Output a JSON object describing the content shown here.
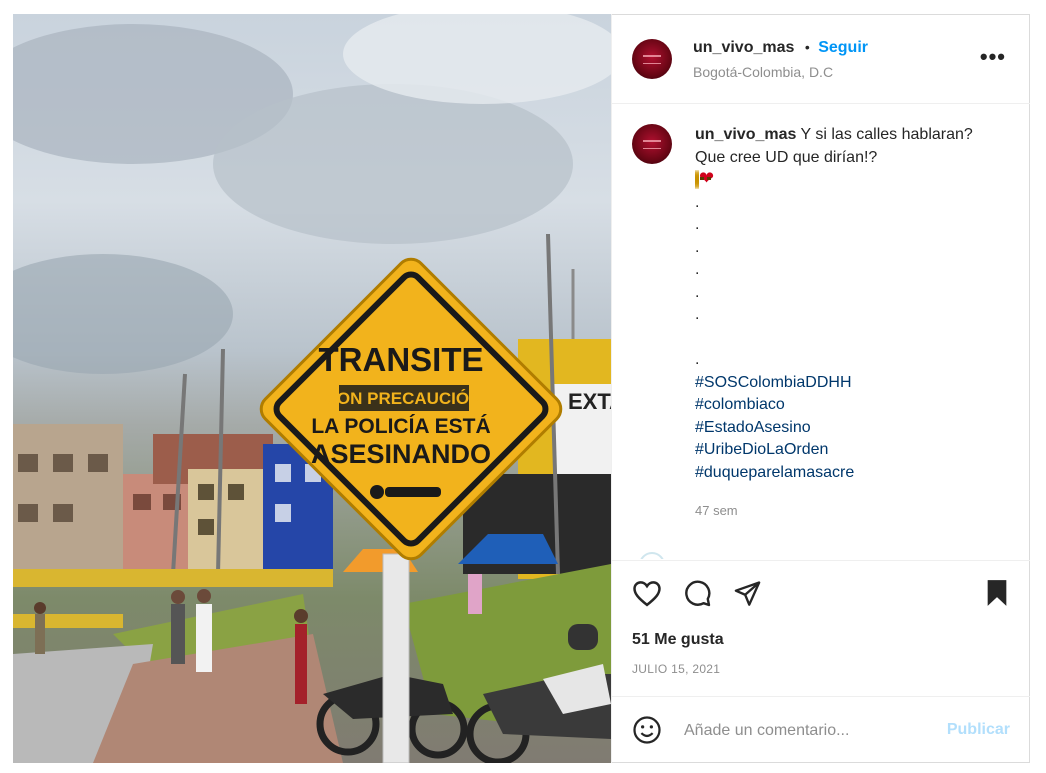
{
  "post": {
    "username": "un_vivo_mas",
    "separator": "•",
    "follow_label": "Seguir",
    "location": "Bogotá-Colombia, D.C",
    "more_label": "•••"
  },
  "photo": {
    "sign_lines": [
      "TRANSITE",
      "CON PRECAUCIÓN",
      "LA POLICÍA ESTÁ",
      "ASESINANDO"
    ],
    "billboard_text": "EXTA"
  },
  "caption": {
    "username": "un_vivo_mas",
    "text_line1": "Y si las calles hablaran?",
    "text_line2": "Que cree UD que dirían!?",
    "emojis": [
      "neutral-face",
      "neutral-face",
      "broken-heart"
    ],
    "dots": [
      ".",
      ".",
      ".",
      ".",
      ".",
      ".",
      "",
      "."
    ],
    "hashtags": [
      "#SOSColombiaDDHH",
      "#colombiaco",
      "#EstadoAsesino",
      "#UribeDioLaOrden",
      "#duqueparelamasacre"
    ],
    "time_ago": "47 sem"
  },
  "actions": {
    "likes": "51 Me gusta",
    "date": "JULIO 15, 2021"
  },
  "comment": {
    "placeholder": "Añade un comentario...",
    "publish_label": "Publicar"
  },
  "colors": {
    "link_blue": "#0095f6",
    "hashtag": "#00376b",
    "muted": "#8e8e8e",
    "publish_disabled": "#b2dffc"
  }
}
